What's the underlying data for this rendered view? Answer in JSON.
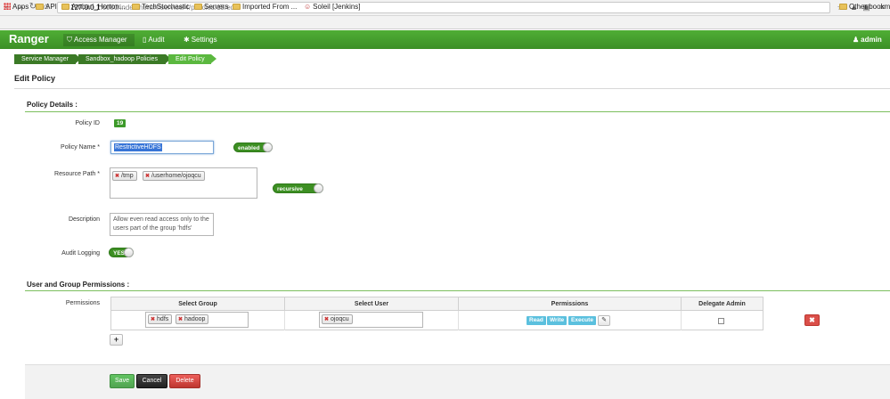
{
  "browser": {
    "url_host": "127.0.0.1",
    "url_rest": ":6080/index.html#!/service/4/policies/19/edit",
    "bookmarks": [
      "Apps",
      "API",
      "Ambari_Horton...",
      "TechStochastic",
      "Servers",
      "Imported From ...",
      "Soleil [Jenkins]"
    ],
    "other_bookmarks": "Other bookm"
  },
  "navbar": {
    "brand": "Ranger",
    "access_manager": "Access Manager",
    "audit": "Audit",
    "settings": "Settings",
    "user": "admin",
    "color": "#45a12d"
  },
  "breadcrumb": [
    "Service Manager",
    "Sandbox_hadoop Policies",
    "Edit Policy"
  ],
  "page_title": "Edit Policy",
  "policy_details": {
    "section_title": "Policy Details :",
    "policy_id_label": "Policy ID",
    "policy_id": "19",
    "policy_name_label": "Policy Name *",
    "policy_name": "RestrictiveHDFS",
    "enabled_label": "enabled",
    "resource_path_label": "Resource Path *",
    "resource_paths": [
      "/tmp",
      "/userhome/ojoqcu"
    ],
    "recursive_label": "recursive",
    "description_label": "Description",
    "description": "Allow even read access only to the users part of the group 'hdfs'",
    "audit_logging_label": "Audit Logging",
    "audit_logging": "YES"
  },
  "permissions": {
    "section_title": "User and Group Permissions :",
    "label": "Permissions",
    "headers": [
      "Select Group",
      "Select User",
      "Permissions",
      "Delegate Admin"
    ],
    "groups": [
      "hdfs",
      "hadoop"
    ],
    "users": [
      "ojoqcu"
    ],
    "perms": [
      "Read",
      "Write",
      "Execute"
    ],
    "delegate_admin": false
  },
  "actions": {
    "save": "Save",
    "cancel": "Cancel",
    "delete": "Delete"
  }
}
